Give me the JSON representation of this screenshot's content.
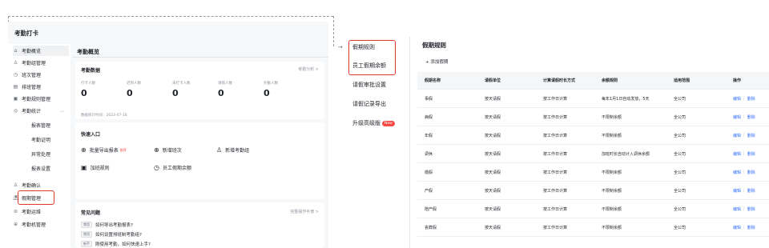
{
  "app": {
    "title": "考勤打卡"
  },
  "sidebar": {
    "items": [
      {
        "label": "考勤概览",
        "icon": "home-icon"
      },
      {
        "label": "考勤组管理",
        "icon": "group-icon"
      },
      {
        "label": "班次管理",
        "icon": "shift-icon"
      },
      {
        "label": "排班管理",
        "icon": "schedule-icon"
      },
      {
        "label": "考勤规则管理",
        "icon": "rule-icon"
      },
      {
        "label": "考勤统计",
        "icon": "stats-icon"
      },
      {
        "label": "报表管理"
      },
      {
        "label": "考勤证明"
      },
      {
        "label": "异常处理"
      },
      {
        "label": "报表设置"
      },
      {
        "label": "考勤确认",
        "icon": "confirm-icon"
      },
      {
        "label": "假期管理",
        "icon": "vacation-icon"
      },
      {
        "label": "考勤运维",
        "icon": "ops-icon"
      },
      {
        "label": "考勤机管理",
        "icon": "device-icon"
      }
    ]
  },
  "main": {
    "title": "考勤概览",
    "attendance": {
      "title": "考勤数据",
      "link": "考勤分析 >",
      "stats": [
        {
          "label": "打卡人数",
          "value": "0"
        },
        {
          "label": "迟到人数",
          "value": "0"
        },
        {
          "label": "未打卡人数",
          "value": "0"
        },
        {
          "label": "请假人数",
          "value": "0"
        },
        {
          "label": "外勤人数",
          "value": "0"
        }
      ],
      "time": "数据统计时间：2023-07-18"
    },
    "quick": {
      "title": "快速入口",
      "items": [
        {
          "label": "批量导出报表",
          "hot": "推荐",
          "icon": "export-icon"
        },
        {
          "label": "新增班次",
          "icon": "add-shift-icon"
        },
        {
          "label": "新增考勤组",
          "icon": "add-group-icon"
        },
        {
          "label": "加班规则",
          "icon": "overtime-icon"
        },
        {
          "label": "员工假期余额",
          "icon": "clock-icon"
        }
      ]
    },
    "faq": {
      "title": "常见问题",
      "link": "完整操作手册 >",
      "items": [
        {
          "tag": "常用",
          "text": "如何导出考勤报表?"
        },
        {
          "tag": "常用",
          "text": "如何设置排班制考勤组?"
        },
        {
          "tag": "新手",
          "text": "刚使用考勤，如何快速上手?"
        }
      ]
    }
  },
  "menu": {
    "items": [
      {
        "label": "假期规则"
      },
      {
        "label": "员工假期余额"
      },
      {
        "label": "请假审批设置"
      },
      {
        "label": "请假记录导出"
      },
      {
        "label": "升级高级版",
        "badge": "New"
      }
    ]
  },
  "rules": {
    "title": "假期规则",
    "add_label": "+ 添加假期",
    "columns": [
      "假期名称",
      "请假单位",
      "计算请假时长方式",
      "余额规则",
      "适用范围",
      "操作"
    ],
    "rows": [
      [
        "事假",
        "按天请假",
        "按工作日计算",
        "每年1月1日自动发放，5天",
        "全公司"
      ],
      [
        "病假",
        "按天请假",
        "按工作日计算",
        "不限制余额",
        "全公司"
      ],
      [
        "年假",
        "按天请假",
        "按工作日计算",
        "不限制余额",
        "全公司"
      ],
      [
        "调休",
        "按天请假",
        "按工作日计算",
        "加班时长自动计入调休余额",
        "全公司"
      ],
      [
        "婚假",
        "按天请假",
        "按工作日计算",
        "不限制余额",
        "全公司"
      ],
      [
        "产假",
        "按天请假",
        "按工作日计算",
        "不限制余额",
        "全公司"
      ],
      [
        "陪产假",
        "按天请假",
        "按工作日计算",
        "不限制余额",
        "全公司"
      ],
      [
        "丧葬假",
        "按天请假",
        "按工作日计算",
        "不限制余额",
        "全公司"
      ]
    ],
    "edit_label": "编辑",
    "delete_label": "删除"
  },
  "colors": {
    "accent": "#3370ff",
    "highlight": "#e03b2a",
    "badge": "#f54a45"
  }
}
